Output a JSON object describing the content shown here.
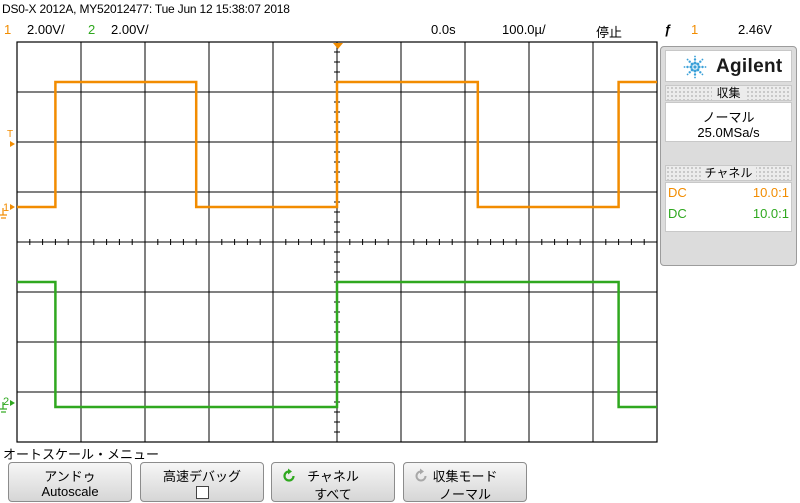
{
  "header": {
    "instrument": "DS0-X 2012A, MY52012477: Tue Jun 12 15:38:07 2018",
    "ch1_num": "1",
    "ch1_scale": "2.00V/",
    "ch2_num": "2",
    "ch2_scale": "2.00V/",
    "time_offset": "0.0s",
    "time_scale": "100.0µ/",
    "run_state": "停止",
    "trigger_icon": "ƒ",
    "trigger_source": "1",
    "trigger_level": "2.46V"
  },
  "markers": {
    "ch1_ground": "1",
    "ch2_ground": "2",
    "trigger_level_marker": "T"
  },
  "panel": {
    "brand": "Agilent",
    "acquire_header": "収集",
    "acquire_mode": "ノーマル",
    "sample_rate": "25.0MSa/s",
    "channel_header": "チャネル",
    "channels": [
      {
        "coupling": "DC",
        "probe": "10.0:1",
        "color": "#f28c00"
      },
      {
        "coupling": "DC",
        "probe": "10.0:1",
        "color": "#2fa81f"
      }
    ]
  },
  "menu": {
    "title": "オートスケール・メニュー",
    "keys": [
      {
        "line1": "アンドゥ",
        "line2": "Autoscale"
      },
      {
        "line1": "高速デバッグ",
        "line2": ""
      },
      {
        "line1": "チャネル",
        "line2": "すべて"
      },
      {
        "line1": "収集モード",
        "line2": "ノーマル"
      }
    ]
  },
  "colors": {
    "ch1": "#f28c00",
    "ch2": "#2fa81f",
    "grid": "#000000",
    "trigger_marker": "#f28c00"
  },
  "icons": {
    "cycle": "refresh-icon",
    "cycle_disabled": "refresh-icon",
    "trigger": "trigger-edge-icon",
    "brand": "agilent-spark-icon"
  },
  "waveforms": {
    "ch1": {
      "high_volts": 5.0,
      "low_volts": 0.0,
      "period_us": 440,
      "duty": 0.5
    },
    "ch2": {
      "high_volts": 5.0,
      "low_volts": 0.0,
      "period_us": 880,
      "duty": 0.5
    }
  }
}
